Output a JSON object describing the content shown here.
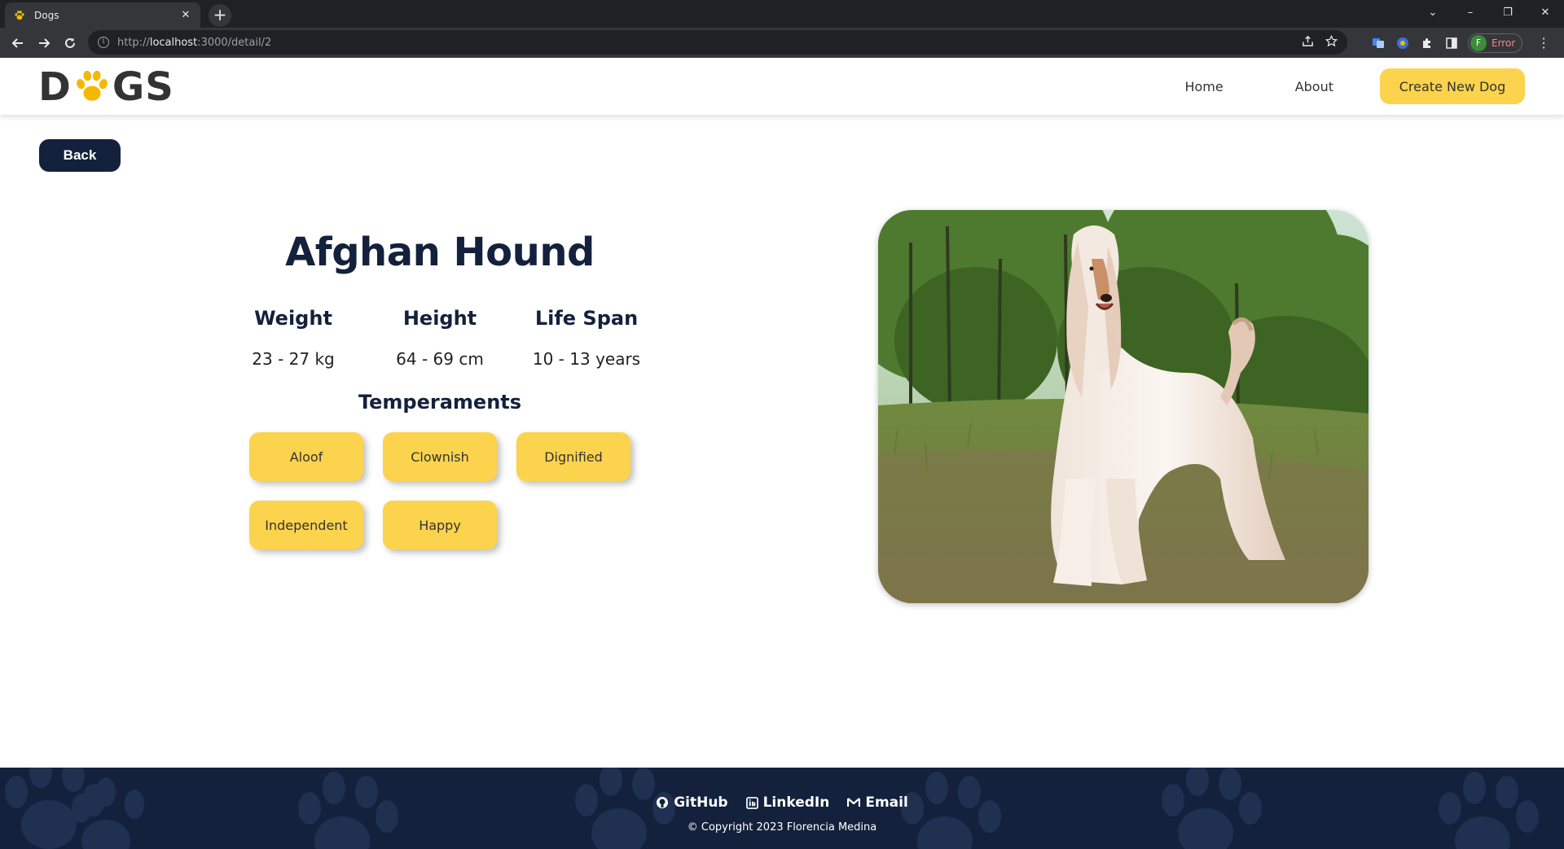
{
  "browser": {
    "tab_title": "Dogs",
    "tab_close": "✕",
    "new_tab": "+",
    "url_prefix": "http://",
    "url_host": "localhost",
    "url_rest": ":3000/detail/2",
    "profile_initial": "F",
    "profile_status": "Error",
    "window_controls": [
      "⌄",
      "–",
      "❐",
      "✕"
    ]
  },
  "header": {
    "logo_left": "D",
    "logo_right": "GS",
    "nav": [
      "Home",
      "About"
    ],
    "create_button": "Create New Dog"
  },
  "back_button": "Back",
  "dog": {
    "name": "Afghan Hound",
    "stats": [
      {
        "label": "Weight",
        "value": "23 - 27 kg"
      },
      {
        "label": "Height",
        "value": "64 - 69 cm"
      },
      {
        "label": "Life Span",
        "value": "10 - 13 years"
      }
    ],
    "temperaments_title": "Temperaments",
    "temperaments": [
      "Aloof",
      "Clownish",
      "Dignified",
      "Independent",
      "Happy"
    ]
  },
  "footer": {
    "links": [
      {
        "label": "GitHub",
        "icon": "github-icon"
      },
      {
        "label": "LinkedIn",
        "icon": "linkedin-icon"
      },
      {
        "label": "Email",
        "icon": "mail-icon"
      }
    ],
    "copyright": "© Copyright 2023 Florencia Medina"
  },
  "colors": {
    "accent_yellow": "#fcd34d",
    "navy": "#13213c",
    "footer_bg": "#13213c"
  }
}
